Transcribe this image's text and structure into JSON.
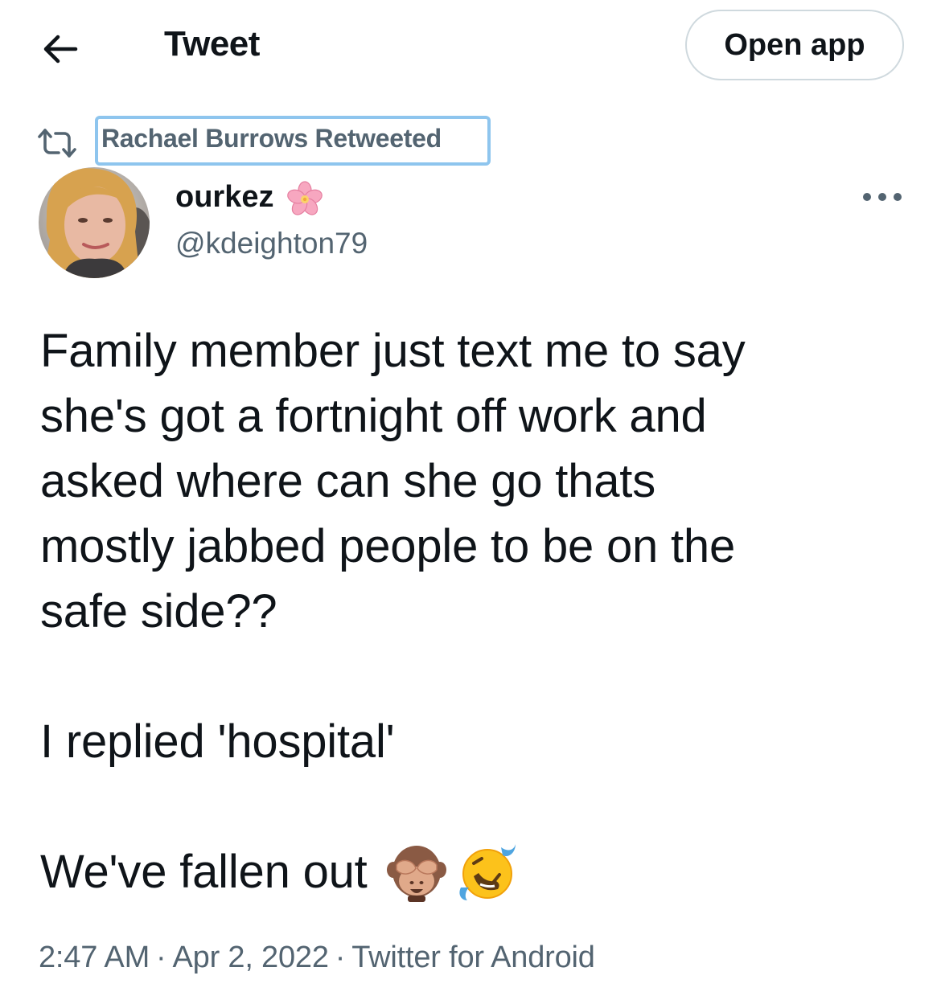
{
  "header": {
    "back_icon": "arrow-left-icon",
    "title": "Tweet",
    "open_app_label": "Open app"
  },
  "retweet": {
    "icon": "retweet-icon",
    "label": "Rachael Burrows Retweeted",
    "highlight_color": "#8ec5ee"
  },
  "author": {
    "name": "ourkez",
    "name_emoji_icon": "cherry-blossom-icon",
    "handle": "@kdeighton79",
    "avatar_icon": "avatar"
  },
  "tweet": {
    "lines": [
      "Family member just text me to say",
      "she's got a fortnight off work and",
      "asked where can she go thats",
      "mostly jabbed people to be on the",
      "safe side??"
    ],
    "reply": "I replied 'hospital'",
    "closing": "We've fallen out",
    "closing_emojis": [
      "see-no-evil-monkey-icon",
      "rolling-on-floor-laughing-icon"
    ]
  },
  "meta": {
    "time": "2:47 AM",
    "separator": "·",
    "date": "Apr 2, 2022",
    "source": "Twitter for Android"
  },
  "colors": {
    "text_primary": "#0f1419",
    "text_secondary": "#536471",
    "border": "#cfd9de"
  }
}
